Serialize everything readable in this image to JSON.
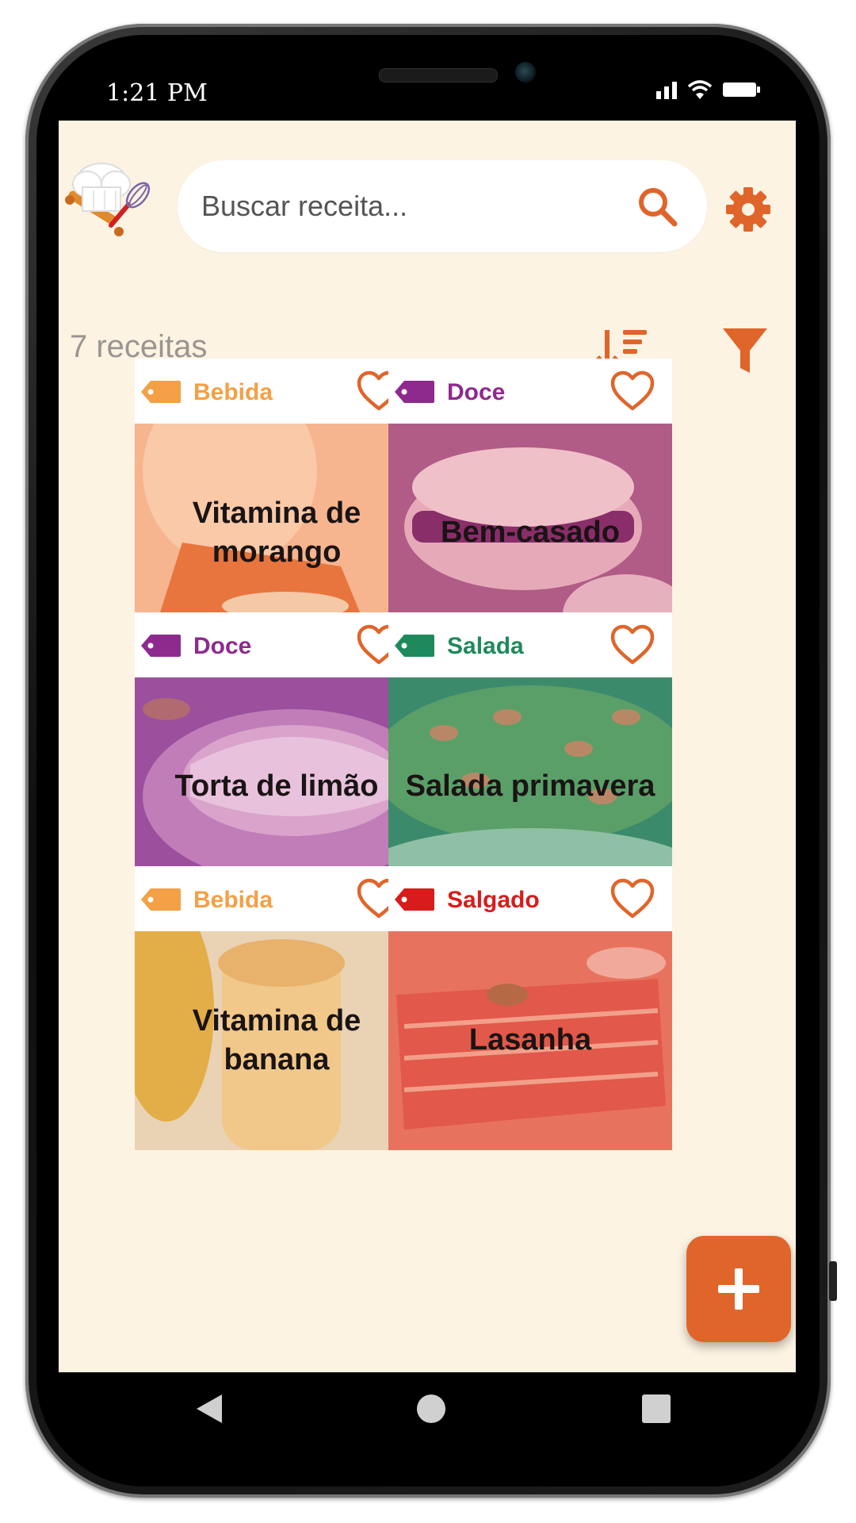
{
  "status_bar": {
    "time": "1:21 PM"
  },
  "header": {
    "search_placeholder": "Buscar receita...",
    "search_icon": "search-icon",
    "settings_icon": "gear-icon"
  },
  "toolbar": {
    "count_text": "7 receitas",
    "sort_icon": "sort-descending-icon",
    "filter_icon": "filter-icon"
  },
  "colors": {
    "accent": "#e0652a",
    "background": "#fdf3e3",
    "bebida": "#f3a046",
    "doce": "#8e2a8e",
    "salada": "#1e8a5c",
    "salgado": "#d81c1c"
  },
  "recipes": [
    {
      "category": "Bebida",
      "title": "Vitamina de morango"
    },
    {
      "category": "Doce",
      "title": "Bem-casado"
    },
    {
      "category": "Doce",
      "title": "Torta de limão"
    },
    {
      "category": "Salada",
      "title": "Salada primavera"
    },
    {
      "category": "Bebida",
      "title": "Vitamina de banana"
    },
    {
      "category": "Salgado",
      "title": "Lasanha"
    }
  ],
  "fab": {
    "icon": "plus-icon"
  },
  "nav": {
    "back_icon": "back-triangle-icon",
    "home_icon": "home-circle-icon",
    "recent_icon": "recent-square-icon"
  }
}
